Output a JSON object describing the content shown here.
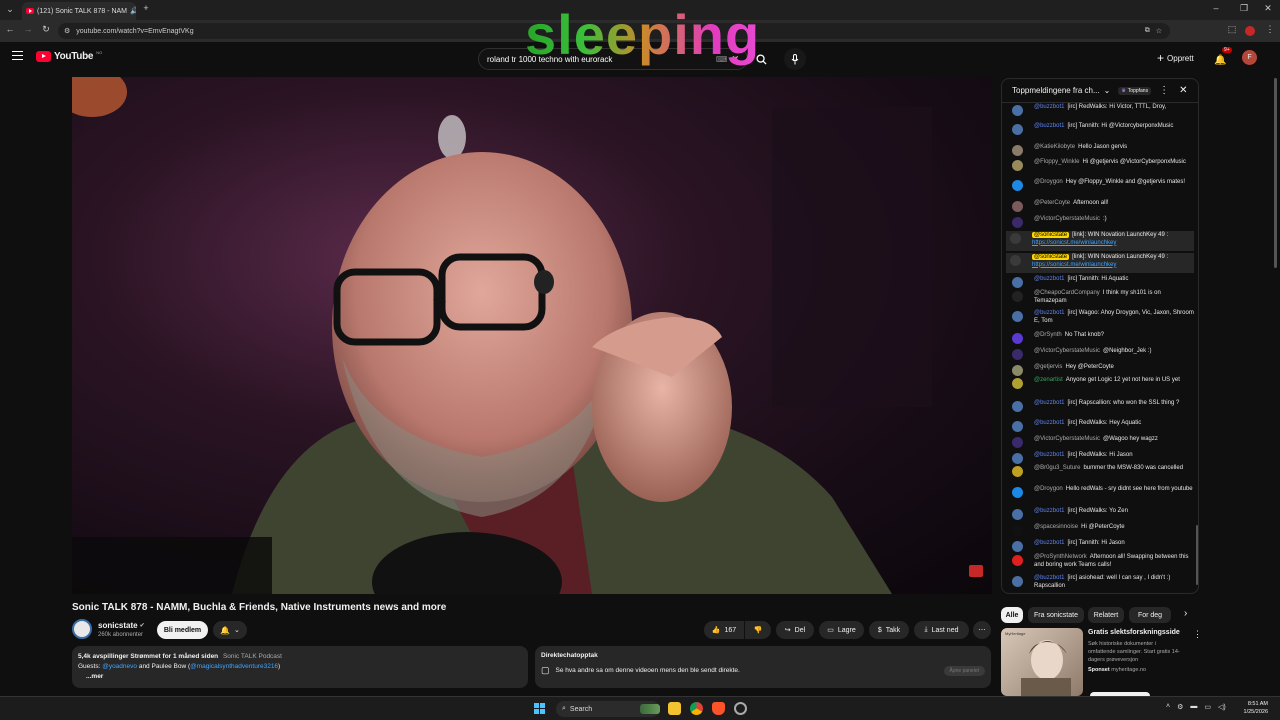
{
  "browser": {
    "tab_title": "(121) Sonic TALK 878 - NAM",
    "url": "youtube.com/watch?v=EmvEnagtVKg"
  },
  "header": {
    "logo_text": "YouTube",
    "logo_region": "NO",
    "search_value": "roland tr 1000 techno with eurorack",
    "create_label": "Opprett",
    "notifications_badge": "9+",
    "avatar_letter": "F"
  },
  "overlay_text": "sleeping",
  "chat": {
    "header_title": "Toppmeldingene fra ch...",
    "fans_label": "Toppfans",
    "messages": [
      {
        "author": "@buzzbot1",
        "text": "[irc] RedWalks: Hi Victor, TTTL, Droy,",
        "color": "#4a6fa5",
        "style": "mod"
      },
      {
        "author": "@buzzbot1",
        "text": "[irc] Tannith: Hi @VictorcyberponxMusic",
        "color": "#4a6fa5",
        "style": "mod"
      },
      {
        "author": "@KatieKilobyte",
        "text": "Hello Jason gervis",
        "color": "#8a7a6a",
        "style": ""
      },
      {
        "author": "@Floppy_Winkle",
        "text": "Hi @getjervis @VictorCyberponxMusic",
        "color": "#9a8a5a",
        "style": ""
      },
      {
        "author": "@Droygon",
        "text": "Hey @Floppy_Winkle and @getjervis mates!",
        "color": "#1e88e5",
        "style": ""
      },
      {
        "author": "@PeterCoyte",
        "text": "Afternoon all!",
        "color": "#7a5a5a",
        "style": ""
      },
      {
        "author": "@VictorCyberstateMusic",
        "text": ":)",
        "color": "#3a2a6a",
        "style": ""
      },
      {
        "author": "@sonicstate",
        "text": "[link]: WIN Novation LaunchKey 49 :",
        "link": "https://sonicst.me/winlaunchkey",
        "color": "#3a3a3a",
        "style": "own"
      },
      {
        "author": "@sonicstate",
        "text": "[link]: WIN Novation LaunchKey 49 :",
        "link": "https://sonicst.me/winlaunchkey",
        "color": "#3a3a3a",
        "style": "own"
      },
      {
        "author": "@buzzbot1",
        "text": "[irc] Tannith: Hi Aquatic",
        "color": "#4a6fa5",
        "style": "mod"
      },
      {
        "author": "@CheapoCardCompany",
        "text": "I think my sh101 is on Temazepam",
        "color": "#222",
        "style": ""
      },
      {
        "author": "@buzzbot1",
        "text": "[irc] Wagoo: Ahoy Droygon, Vic, Jaxon, Shroom E, Tom",
        "color": "#4a6fa5",
        "style": "mod"
      },
      {
        "author": "@DrSynth",
        "text": "No That knob?",
        "color": "#5a3ad0",
        "style": ""
      },
      {
        "author": "@VictorCyberstateMusic",
        "text": "@Neighbor_Jek :)",
        "color": "#3a2a6a",
        "style": ""
      },
      {
        "author": "@getjervis",
        "text": "Hey @PeterCoyte",
        "color": "#8a8a6a",
        "style": ""
      },
      {
        "author": "@zenartist",
        "text": "Anyone get Logic 12 yet not here in US yet",
        "color": "#b0a030",
        "style": "green"
      },
      {
        "author": "@buzzbot1",
        "text": "[irc] Rapscallion: who won the SSL thing ?",
        "color": "#4a6fa5",
        "style": "mod"
      },
      {
        "author": "@buzzbot1",
        "text": "[irc] RedWalks: Hey Aquatic",
        "color": "#4a6fa5",
        "style": "mod"
      },
      {
        "author": "@VictorCyberstateMusic",
        "text": "@Wagoo hey wagzz",
        "color": "#3a2a6a",
        "style": ""
      },
      {
        "author": "@buzzbot1",
        "text": "[irc] RedWalks: Hi Jason",
        "color": "#4a6fa5",
        "style": "mod"
      },
      {
        "author": "@Br0gu3_Suture",
        "text": "bummer the MSW-830 was cancelled",
        "color": "#c0a020",
        "style": ""
      },
      {
        "author": "@Droygon",
        "text": "Hello redWals - sry didnt see here from youtube",
        "color": "#1e88e5",
        "style": ""
      },
      {
        "author": "@buzzbot1",
        "text": "[irc] RedWalks: Yo Zen",
        "color": "#4a6fa5",
        "style": "mod"
      },
      {
        "author": "@spacesinnoise",
        "text": "Hi @PeterCoyte",
        "color": "#111",
        "style": ""
      },
      {
        "author": "@buzzbot1",
        "text": "[irc] Tannith: Hi Jason",
        "color": "#4a6fa5",
        "style": "mod"
      },
      {
        "author": "@ProSynthNetwork",
        "text": "Afternoon all! Swapping between this and boring work Teams calls!",
        "color": "#e02020",
        "style": ""
      },
      {
        "author": "@buzzbot1",
        "text": "[irc] asiohead: well I can say , I didn't :) Rapscallion",
        "color": "#4a6fa5",
        "style": "mod"
      }
    ]
  },
  "video": {
    "title": "Sonic TALK 878 - NAMM, Buchla & Friends, Native Instruments news and more",
    "channel_name": "sonicstate",
    "subscribers": "260k abonnenter",
    "join_label": "Bli medlem",
    "likes": "167",
    "share_label": "Del",
    "save_label": "Lagre",
    "thanks_label": "Takk",
    "download_label": "Last ned"
  },
  "description": {
    "stats": "5,4k avspillinger  Strømmet for 1 måned siden",
    "podcast": "Sonic TALK Podcast",
    "guests_prefix": "Guests:",
    "guest1": "@yoadnevo",
    "guests_mid": "and Paulee Bow (",
    "guest2": "@magicalsynthadventure3216",
    "guests_suffix": ")",
    "more": "...mer"
  },
  "replay": {
    "title": "Direktechatopptak",
    "text": "Se hva andre sa om denne videoen mens den ble sendt direkte.",
    "open_label": "Åpne panelet"
  },
  "chips": [
    "Alle",
    "Fra sonicstate",
    "Relatert",
    "For deg"
  ],
  "ad": {
    "title": "Gratis slektsforskningsside",
    "body": "Søk historiske dokumenter i omfattende samlinger. Start gratis 14-dagers prøveversjon",
    "sponsored": "Sponset",
    "domain": "myheritage.no",
    "brand": "MyHeritage"
  },
  "taskbar": {
    "search_label": "Search",
    "time": "8:51 AM",
    "date": "1/25/2026"
  }
}
